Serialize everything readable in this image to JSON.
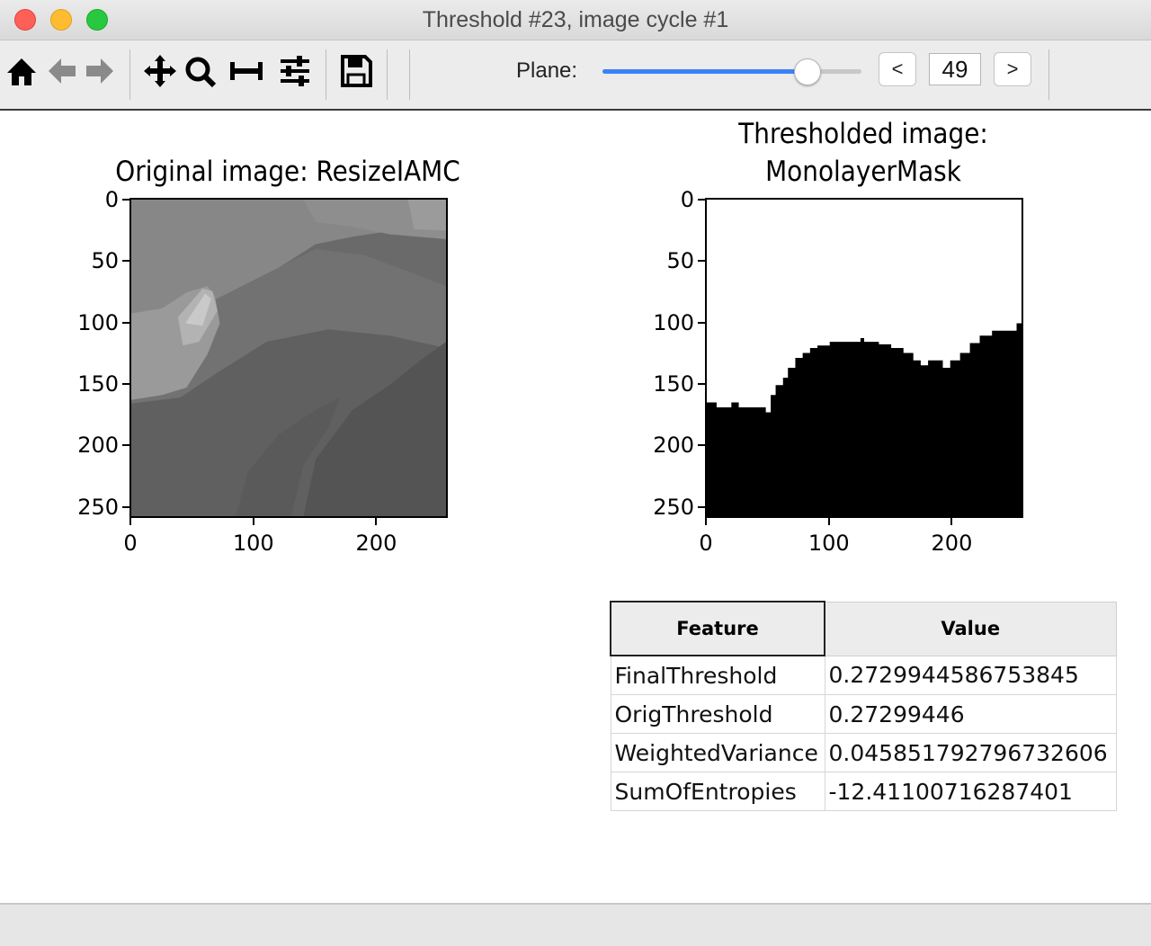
{
  "window": {
    "title": "Threshold #23, image cycle #1",
    "buttons": [
      "close",
      "minimize",
      "zoom"
    ]
  },
  "toolbar": {
    "tools": [
      {
        "name": "home-icon",
        "label": "Home"
      },
      {
        "name": "back-arrow-icon",
        "label": "Back"
      },
      {
        "name": "forward-arrow-icon",
        "label": "Forward"
      },
      {
        "name": "pan-move-icon",
        "label": "Pan"
      },
      {
        "name": "zoom-magnifier-icon",
        "label": "Zoom"
      },
      {
        "name": "subplot-adjust-icon",
        "label": "Subplots"
      },
      {
        "name": "configure-sliders-icon",
        "label": "Customize"
      },
      {
        "name": "save-floppy-icon",
        "label": "Save"
      }
    ],
    "plane_label": "Plane:",
    "plane_slider_fraction": 0.79,
    "prev_label": "<",
    "next_label": ">",
    "plane_value": "49"
  },
  "figures": {
    "original": {
      "title": "Original image: ResizeIAMC",
      "yticks": [
        "0",
        "50",
        "100",
        "150",
        "200",
        "250"
      ],
      "xticks": [
        "0",
        "100",
        "200"
      ],
      "extent": [
        0,
        256
      ]
    },
    "thresholded": {
      "title_line1": "Thresholded image:",
      "title_line2": "MonolayerMask",
      "yticks": [
        "0",
        "50",
        "100",
        "150",
        "200",
        "250"
      ],
      "xticks": [
        "0",
        "100",
        "200"
      ],
      "extent": [
        0,
        256
      ]
    }
  },
  "table": {
    "headers": [
      "Feature",
      "Value"
    ],
    "rows": [
      [
        "FinalThreshold",
        "0.2729944586753845"
      ],
      [
        "OrigThreshold",
        "0.27299446"
      ],
      [
        "WeightedVariance",
        "0.045851792796732606"
      ],
      [
        "SumOfEntropies",
        "-12.41100716287401"
      ]
    ]
  },
  "colors": {
    "slider_accent": "#3b82f6",
    "mask_fill": "#000000",
    "mask_background": "#ffffff"
  }
}
